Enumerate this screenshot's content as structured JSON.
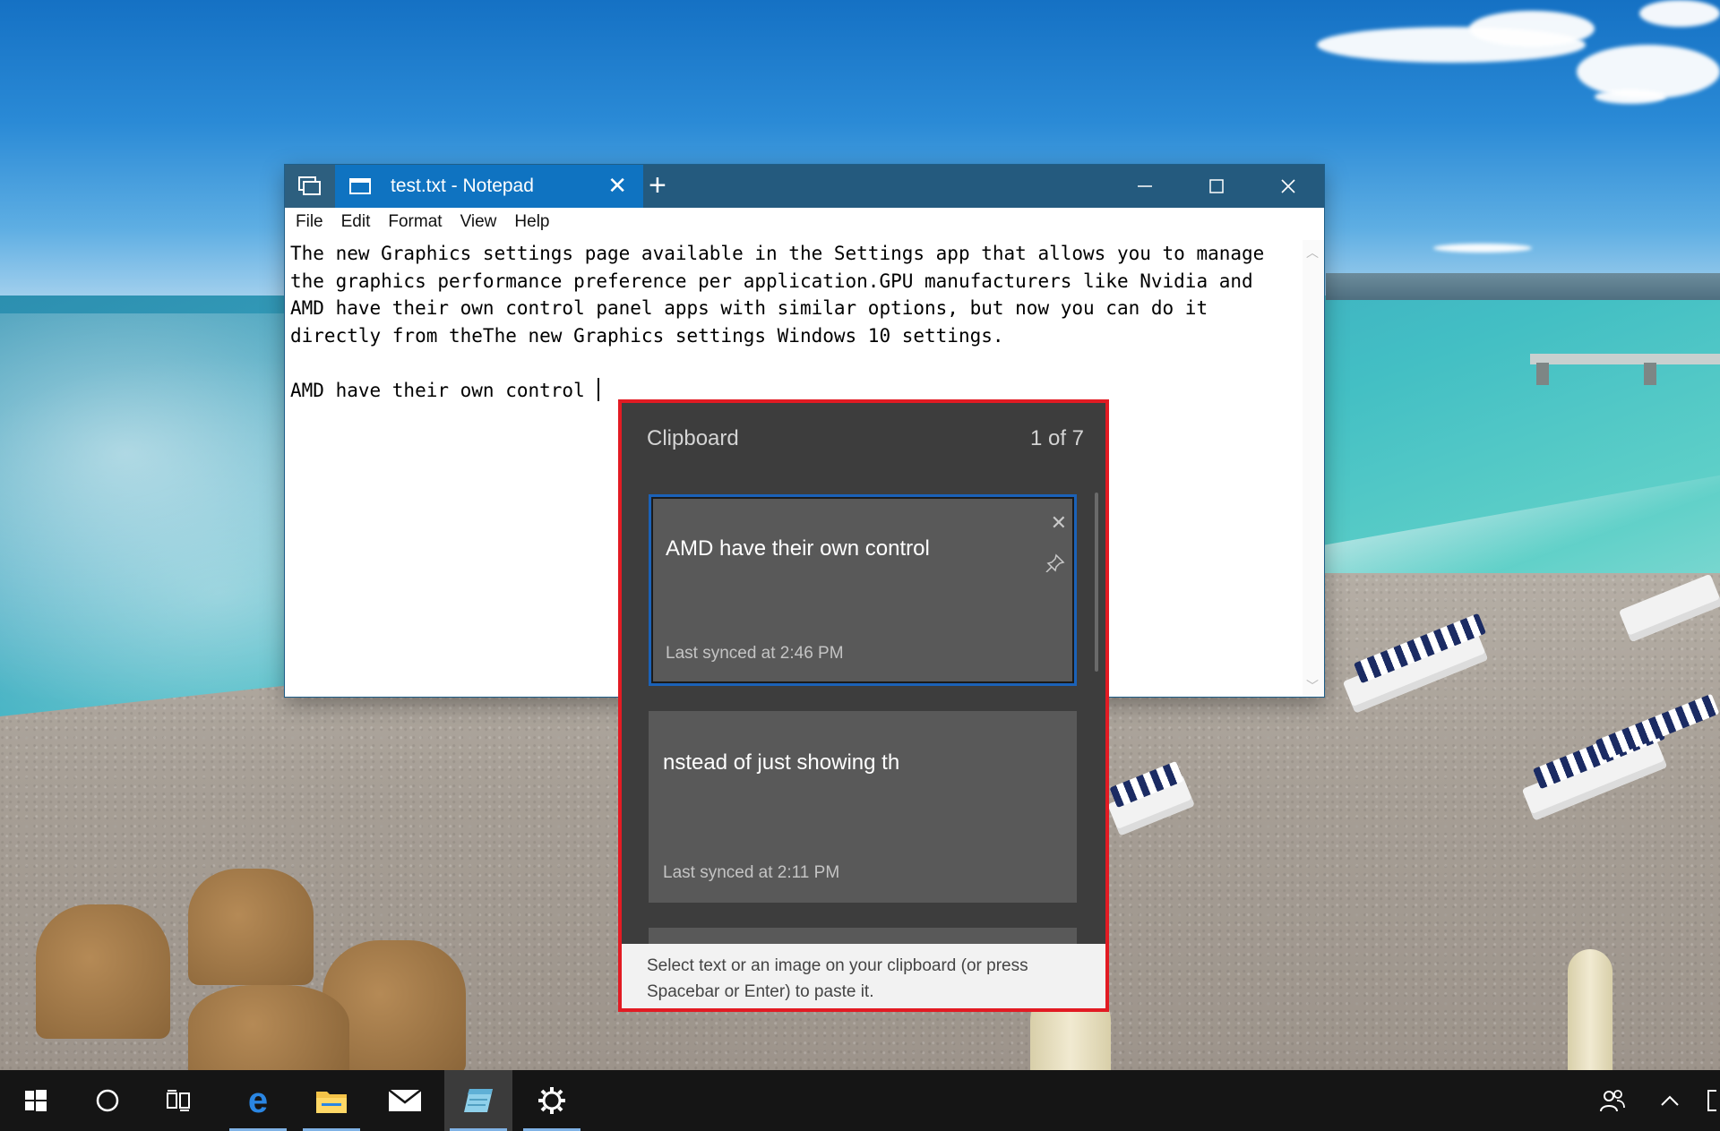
{
  "notepad": {
    "tab_title": "test.txt - Notepad",
    "menu": [
      "File",
      "Edit",
      "Format",
      "View",
      "Help"
    ],
    "content_paragraph": "The new Graphics settings page available in the Settings app that allows you to manage the graphics performance preference per application.GPU manufacturers like Nvidia and AMD have their own control panel apps with similar options, but now you can do it directly from theThe new Graphics settings Windows 10 settings.",
    "content_line2": "AMD have their own control "
  },
  "clipboard": {
    "title": "Clipboard",
    "count": "1 of 7",
    "items": [
      {
        "text": "AMD have their own control",
        "synced": "Last synced at 2:46 PM"
      },
      {
        "text": "nstead of just showing th",
        "synced": "Last synced at 2:11 PM"
      }
    ],
    "footer": "Select text or an image on your clipboard (or press Spacebar or Enter) to paste it."
  },
  "taskbar": {
    "icons": [
      "start-icon",
      "cortana-icon",
      "task-view-icon",
      "edge-icon",
      "file-explorer-icon",
      "mail-icon",
      "notepad-icon",
      "settings-icon",
      "people-icon",
      "chevron-up-icon"
    ]
  },
  "colors": {
    "accent": "#0f73c1",
    "titlebar": "#245a7e",
    "highlight_outline": "#e21b23",
    "clipboard_bg": "#3d3d3d",
    "taskbar": "#151515"
  }
}
